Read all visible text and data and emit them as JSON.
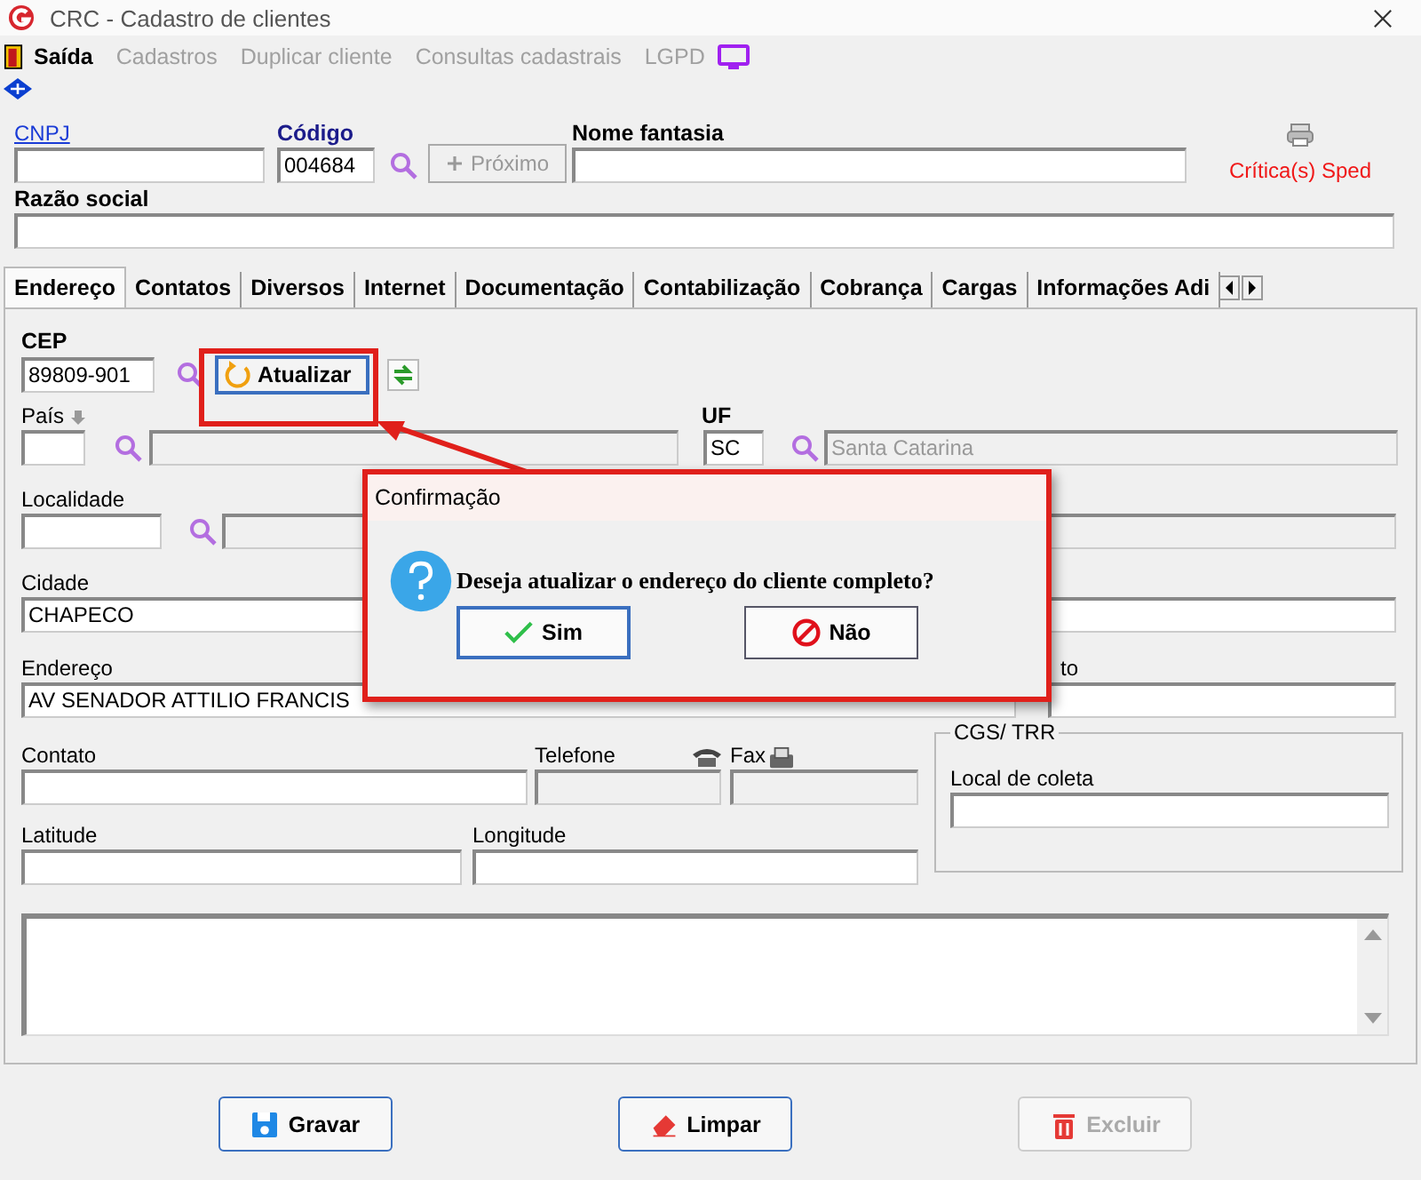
{
  "window": {
    "title": "CRC - Cadastro de clientes"
  },
  "menu": [
    {
      "label": "Saída",
      "disabled": false
    },
    {
      "label": "Cadastros",
      "disabled": true
    },
    {
      "label": "Duplicar cliente",
      "disabled": true
    },
    {
      "label": "Consultas cadastrais",
      "disabled": true
    },
    {
      "label": "LGPD",
      "disabled": true
    }
  ],
  "header": {
    "cnpj_label": "CNPJ",
    "codigo_label": "Código",
    "codigo": "004684",
    "next_button": {
      "label": "Próximo",
      "disabled": true
    },
    "nome_fantasia_label": "Nome fantasia",
    "sped_label": "Crítica(s) Sped",
    "razao_social_label": "Razão social"
  },
  "tabs": [
    {
      "label": "Endereço",
      "selected": true
    },
    {
      "label": "Contatos",
      "selected": false
    },
    {
      "label": "Diversos",
      "selected": false
    },
    {
      "label": "Internet",
      "selected": false
    },
    {
      "label": "Documentação",
      "selected": false
    },
    {
      "label": "Contabilização",
      "selected": false
    },
    {
      "label": "Cobrança",
      "selected": false
    },
    {
      "label": "Cargas",
      "selected": false
    },
    {
      "label": "Informações Adi",
      "selected": false
    }
  ],
  "address": {
    "cep_label": "CEP",
    "cep": "89809-901",
    "update_button": "Atualizar",
    "pais_label": "País",
    "uf_label": "UF",
    "uf": "SC",
    "estado": "Santa Catarina",
    "localidade_label": "Localidade",
    "cidade_label": "Cidade",
    "cidade": "CHAPECO",
    "endereco_label": "Endereço",
    "endereco": "AV SENADOR ATTILIO FRANCIS",
    "label_partial": "to",
    "contato_label": "Contato",
    "telefone_label": "Telefone",
    "fax_label": "Fax",
    "group_title": "CGS/ TRR",
    "local_coleta_label": "Local de coleta",
    "latitude_label": "Latitude",
    "longitude_label": "Longitude"
  },
  "dialog": {
    "title": "Confirmação",
    "message": "Deseja atualizar o endereço do cliente completo?",
    "buttons": [
      {
        "label": "Sim",
        "kind": "yes"
      },
      {
        "label": "Não",
        "kind": "no"
      }
    ]
  },
  "footer_buttons": [
    {
      "label": "Gravar",
      "kind": "save",
      "disabled": false
    },
    {
      "label": "Limpar",
      "kind": "clear",
      "disabled": false
    },
    {
      "label": "Excluir",
      "kind": "delete",
      "disabled": true
    }
  ]
}
